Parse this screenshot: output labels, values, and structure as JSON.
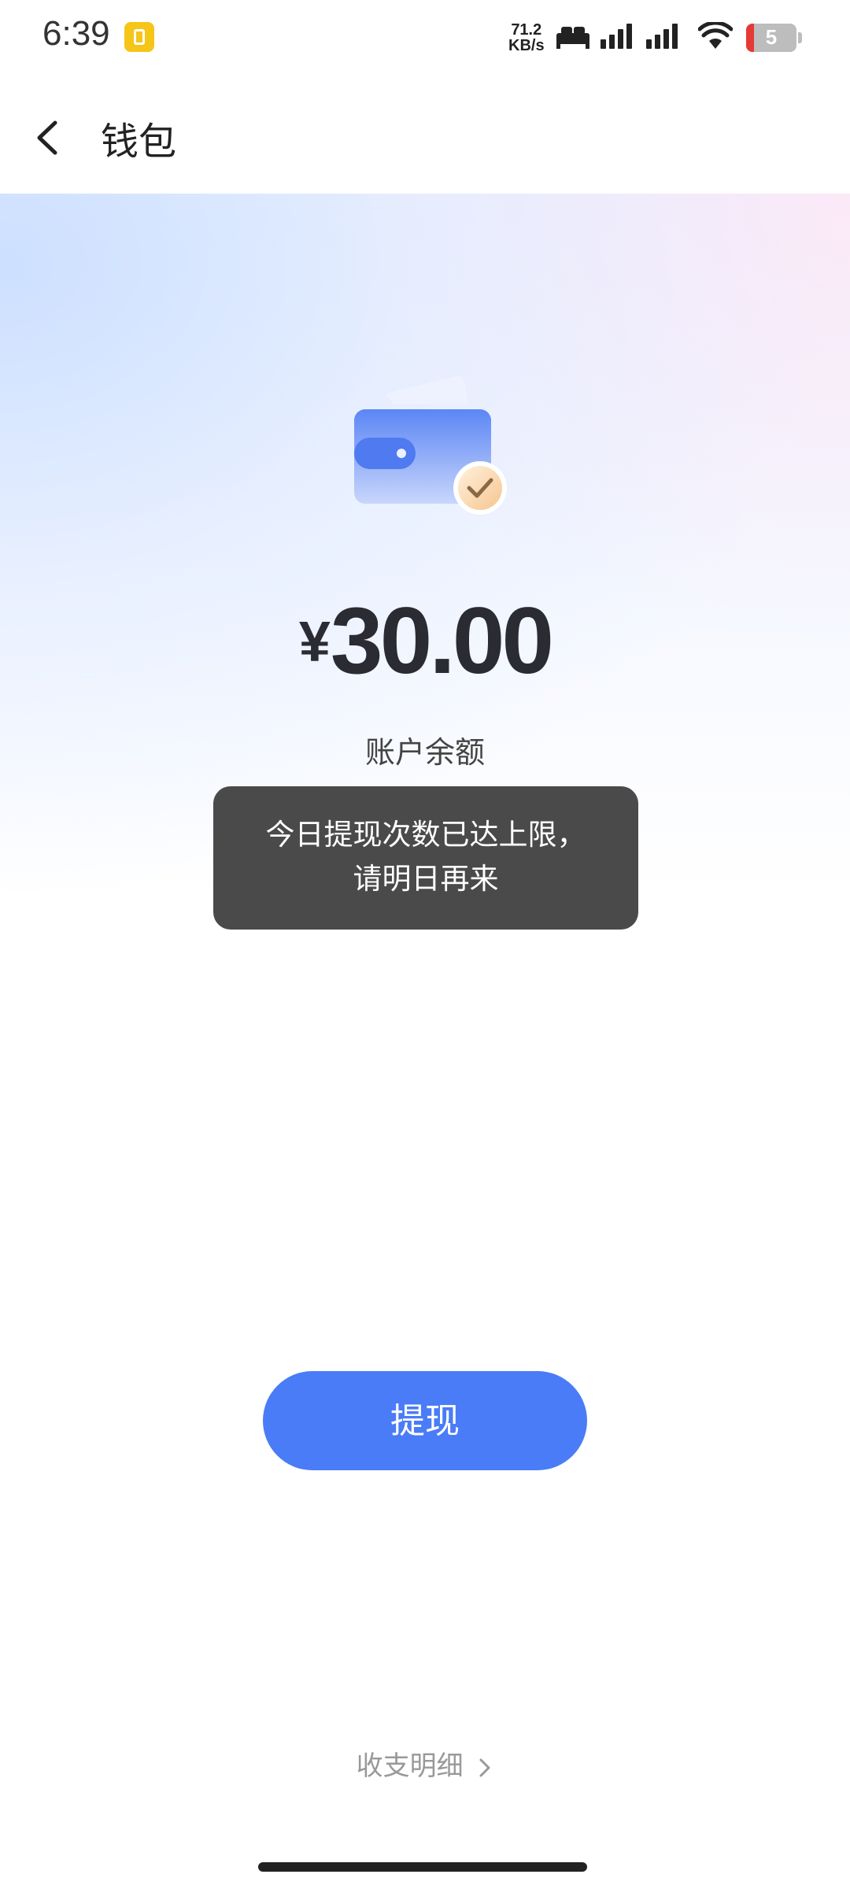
{
  "status_bar": {
    "time": "6:39",
    "net_speed_value": "71.2",
    "net_speed_unit": "KB/s",
    "battery_level": "5",
    "icons": [
      "notification-app-icon",
      "sleep-mode-icon",
      "signal-icon",
      "signal-icon",
      "wifi-icon",
      "battery-icon"
    ]
  },
  "nav": {
    "title": "钱包",
    "back_icon": "chevron-left-icon"
  },
  "wallet": {
    "illustration_icon": "wallet-check-icon",
    "currency_symbol": "¥",
    "balance": "30.00",
    "balance_label": "账户余额"
  },
  "toast": {
    "line1": "今日提现次数已达上限，",
    "line2": "请明日再来"
  },
  "actions": {
    "withdraw_label": "提现",
    "details_label": "收支明细",
    "details_icon": "chevron-right-icon"
  },
  "colors": {
    "primary": "#4a7cf7",
    "toast_bg": "#4a4a4a",
    "text_dark": "#2b2b33"
  }
}
